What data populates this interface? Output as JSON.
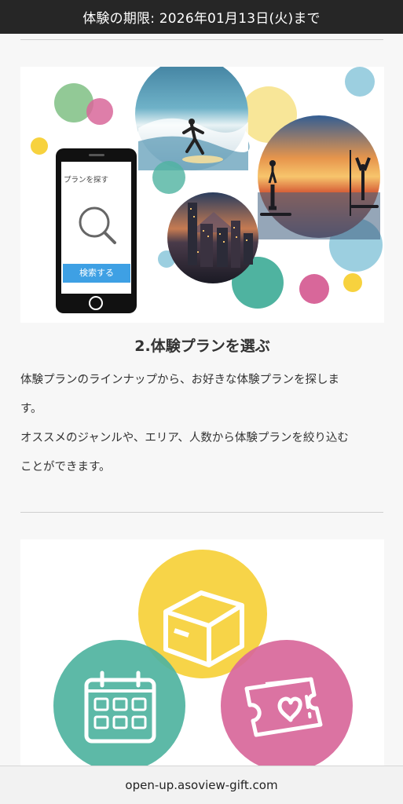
{
  "header": {
    "expiry_text": "体験の期限: 2026年01月13日(火)まで"
  },
  "illustration1": {
    "phone_heading": "プランを探す",
    "phone_button": "検索する"
  },
  "step": {
    "title": "2.体験プランを選ぶ",
    "desc_lines": [
      "体験プランのラインナップから、お好きな体験プランを探しま",
      "す。",
      "オススメのジャンルや、エリア、人数から体験プランを絞り込む",
      "ことができます。"
    ]
  },
  "address_bar": {
    "url": "open-up.asoview-gift.com"
  },
  "colors": {
    "header_bg": "#262626",
    "green": "#4fb3a0",
    "yellow": "#f7d23e",
    "pink": "#d8679a",
    "blue": "#9ccfe0",
    "button_blue": "#3ea0e4"
  },
  "icons": [
    "magnifier-icon",
    "box-icon",
    "calendar-icon",
    "ticket-heart-icon"
  ]
}
